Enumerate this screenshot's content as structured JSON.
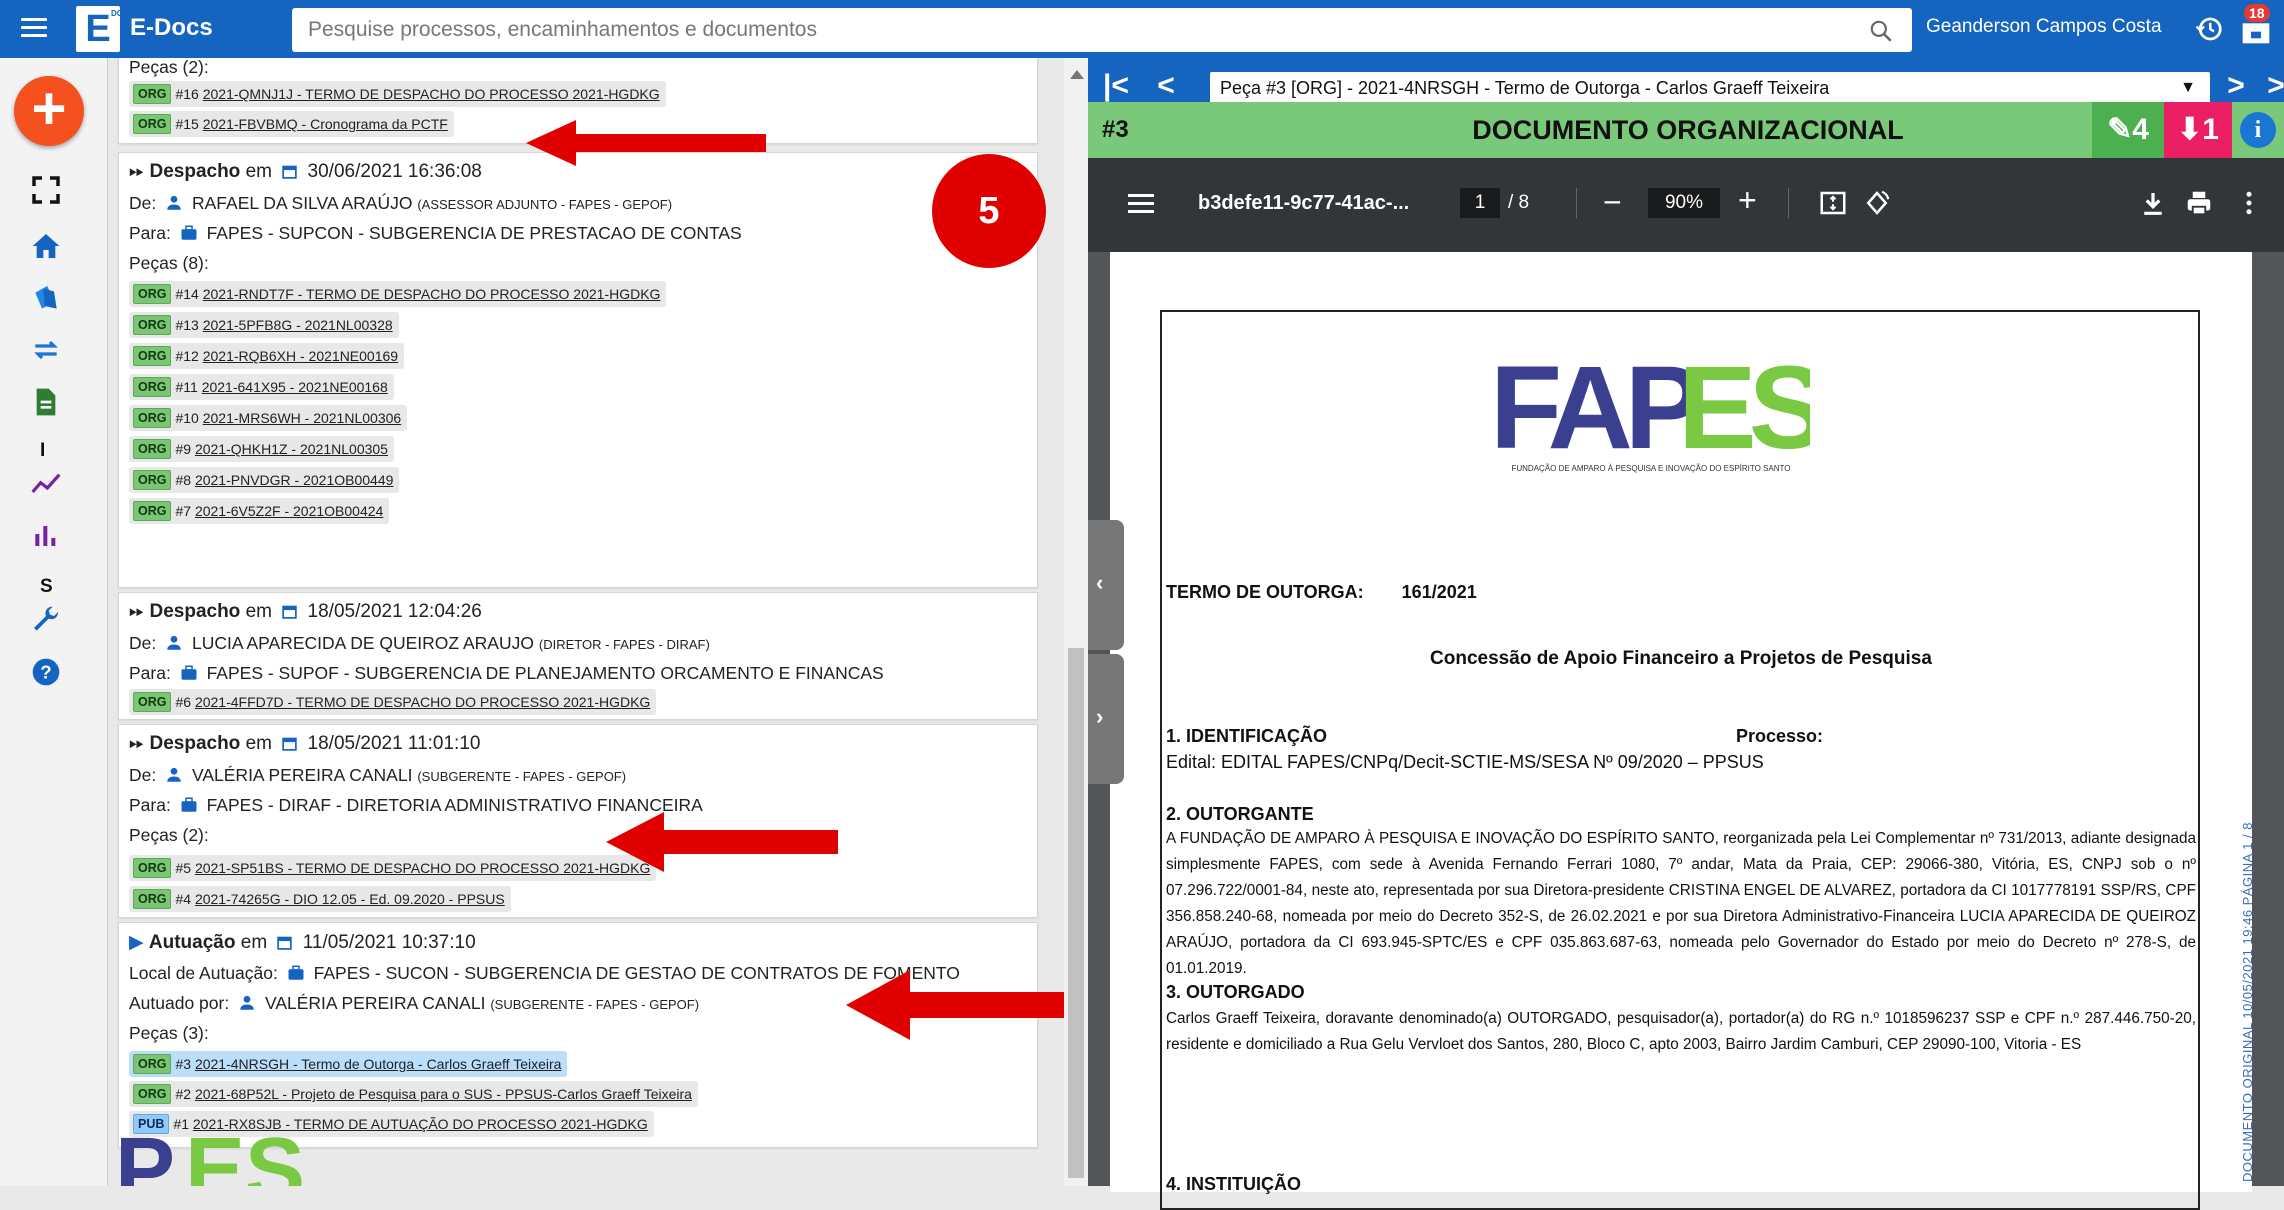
{
  "topbar": {
    "app_name": "E-Docs",
    "logo_letter": "E",
    "logo_small": "DOCS",
    "search_placeholder": "Pesquise processos, encaminhamentos e documentos",
    "user_name": "Geanderson Campos Costa",
    "notification_count": "18"
  },
  "sidebar": {
    "fab_label": "+",
    "letter_i": "I",
    "letter_s": "S"
  },
  "timeline": {
    "top": {
      "pieces_label": "Peças (2):",
      "chips": [
        {
          "tag": "ORG",
          "text": "#16 ",
          "link": "2021-QMNJ1J - TERMO DE DESPACHO DO PROCESSO 2021-HGDKG"
        },
        {
          "tag": "ORG",
          "text": "#15 ",
          "link": "2021-FBVBMQ - Cronograma da PCTF"
        }
      ]
    },
    "despacho1": {
      "type": "Despacho",
      "em": "em",
      "date": "30/06/2021 16:36:08",
      "de_label": "De:",
      "de_name": "RAFAEL DA SILVA ARAÚJO",
      "de_role": "(ASSESSOR ADJUNTO - FAPES - GEPOF)",
      "para_label": "Para:",
      "para_name": "FAPES - SUPCON - SUBGERENCIA DE PRESTACAO DE CONTAS",
      "pieces_label": "Peças (8):",
      "chips": [
        {
          "tag": "ORG",
          "text": "#14 ",
          "link": "2021-RNDT7F - TERMO DE DESPACHO DO PROCESSO 2021-HGDKG"
        },
        {
          "tag": "ORG",
          "text": "#13 ",
          "link": "2021-5PFB8G - 2021NL00328"
        },
        {
          "tag": "ORG",
          "text": "#12 ",
          "link": "2021-RQB6XH - 2021NE00169"
        },
        {
          "tag": "ORG",
          "text": "#11 ",
          "link": "2021-641X95 - 2021NE00168"
        },
        {
          "tag": "ORG",
          "text": "#10 ",
          "link": "2021-MRS6WH - 2021NL00306"
        },
        {
          "tag": "ORG",
          "text": "#9 ",
          "link": "2021-QHKH1Z - 2021NL00305"
        },
        {
          "tag": "ORG",
          "text": "#8 ",
          "link": "2021-PNVDGR - 2021OB00449"
        },
        {
          "tag": "ORG",
          "text": "#7 ",
          "link": "2021-6V5Z2F - 2021OB00424"
        }
      ]
    },
    "despacho2": {
      "type": "Despacho",
      "em": "em",
      "date": "18/05/2021 12:04:26",
      "de_label": "De:",
      "de_name": "LUCIA APARECIDA DE QUEIROZ ARAUJO",
      "de_role": "(DIRETOR - FAPES - DIRAF)",
      "para_label": "Para:",
      "para_name": "FAPES - SUPOF - SUBGERENCIA DE PLANEJAMENTO ORCAMENTO E FINANCAS",
      "chips": [
        {
          "tag": "ORG",
          "text": "#6 ",
          "link": "2021-4FFD7D - TERMO DE DESPACHO DO PROCESSO 2021-HGDKG"
        }
      ]
    },
    "despacho3": {
      "type": "Despacho",
      "em": "em",
      "date": "18/05/2021 11:01:10",
      "de_label": "De:",
      "de_name": "VALÉRIA PEREIRA CANALI",
      "de_role": "(SUBGERENTE - FAPES - GEPOF)",
      "para_label": "Para:",
      "para_name": "FAPES - DIRAF - DIRETORIA ADMINISTRATIVO FINANCEIRA",
      "pieces_label": "Peças (2):",
      "chips": [
        {
          "tag": "ORG",
          "text": "#5 ",
          "link": "2021-SP51BS - TERMO DE DESPACHO DO PROCESSO 2021-HGDKG"
        },
        {
          "tag": "ORG",
          "text": "#4 ",
          "link": "2021-74265G - DIO 12.05 - Ed. 09.2020 - PPSUS"
        }
      ]
    },
    "autuacao": {
      "type": "Autuação",
      "em": "em",
      "date": "11/05/2021 10:37:10",
      "local_label": "Local de Autuação:",
      "local_name": "FAPES - SUCON - SUBGERENCIA DE GESTAO DE CONTRATOS DE FOMENTO",
      "by_label": "Autuado por:",
      "by_name": "VALÉRIA PEREIRA CANALI",
      "by_role": "(SUBGERENTE - FAPES - GEPOF)",
      "pieces_label": "Peças (3):",
      "chips": [
        {
          "tag": "ORG",
          "text": "#3 ",
          "link": "2021-4NRSGH - Termo de Outorga - Carlos Graeff Teixeira"
        },
        {
          "tag": "ORG",
          "text": "#2 ",
          "link": "2021-68P52L - Projeto de Pesquisa para o SUS - PPSUS-Carlos Graeff Teixeira"
        },
        {
          "tag": "PUB",
          "text": "#1 ",
          "link": "2021-RX8SJB - TERMO DE AUTUAÇÃO DO PROCESSO 2021-HGDKG"
        }
      ]
    },
    "badge_number": "5"
  },
  "viewer": {
    "selected_doc": "Peça #3 [ORG] - 2021-4NRSGH - Termo de Outorga - Carlos Graeff Teixeira",
    "doc_number": "#3",
    "doc_kind": "DOCUMENTO ORGANIZACIONAL",
    "edit_count": "4",
    "attach_count": "1",
    "info_label": "i",
    "pdf": {
      "file_name": "b3defe11-9c77-41ac-...",
      "page_current": "1",
      "page_total": "/ 8",
      "zoom": "90%"
    },
    "page": {
      "logo_text": "FAPES",
      "logo_sub": "FUNDAÇÃO DE AMPARO À PESQUISA E INOVAÇÃO DO ESPÍRITO SANTO",
      "termo_label": "TERMO DE OUTORGA:",
      "termo_number": "161/2021",
      "subtitle": "Concessão de Apoio Financeiro a Projetos de Pesquisa",
      "s1_title": "1. IDENTIFICAÇÃO",
      "s1_processo": "Processo:",
      "s1_edital": "Edital:  EDITAL FAPES/CNPq/Decit-SCTIE-MS/SESA Nº 09/2020 – PPSUS",
      "s2_title": "2. OUTORGANTE",
      "s2_text": "A FUNDAÇÃO DE AMPARO À PESQUISA E INOVAÇÃO DO ESPÍRITO SANTO, reorganizada pela Lei Complementar nº 731/2013, adiante designada simplesmente FAPES, com sede à Avenida Fernando Ferrari 1080, 7º andar, Mata da Praia, CEP: 29066-380, Vitória, ES, CNPJ sob o nº 07.296.722/0001-84, neste ato, representada por sua Diretora-presidente CRISTINA ENGEL DE ALVAREZ, portadora da CI 1017778191 SSP/RS, CPF 356.858.240-68, nomeada por meio do Decreto 352-S, de 26.02.2021 e por sua Diretora Administrativo-Financeira LUCIA APARECIDA DE QUEIROZ ARAÚJO, portadora da CI 693.945-SPTC/ES e CPF 035.863.687-63, nomeada pelo Governador do Estado por meio do Decreto nº 278-S, de 01.01.2019.",
      "s3_title": "3. OUTORGADO",
      "s3_text": "Carlos Graeff Teixeira, doravante denominado(a) OUTORGADO, pesquisador(a), portador(a) do RG n.º 1018596237 SSP e CPF n.º 287.446.750-20, residente e domiciliado a Rua Gelu Vervloet dos Santos, 280, Bloco C, apto 2003, Bairro Jardim Camburi, CEP 29090-100, Vitoria - ES",
      "s4_title": "4. INSTITUIÇÃO",
      "side_stamp": "DOCUMENTO ORIGINAL    10/05/2021 19:46    PÁGINA 1 / 8"
    }
  },
  "colors": {
    "primary": "#1565c0",
    "green_bar": "#7ac97a",
    "fab": "#f4511e",
    "arrow": "#e00000"
  }
}
